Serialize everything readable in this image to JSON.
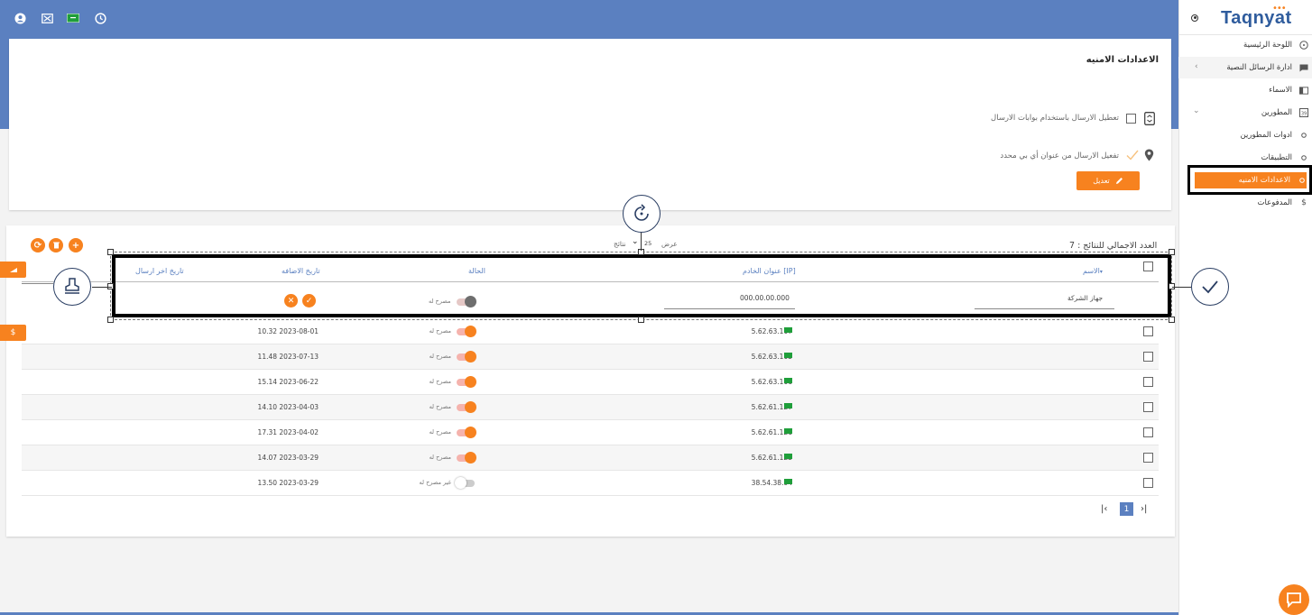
{
  "brand": {
    "name": "Taqnyat",
    "accent": "#f7821f",
    "primary": "#5b80c0"
  },
  "topbar": {
    "icons": [
      "user-icon",
      "expand-icon",
      "flag-icon",
      "clock-icon"
    ]
  },
  "sidebar": {
    "items": [
      {
        "label": "اللوحة الرئيسية",
        "icon": "dashboard-icon"
      },
      {
        "label": "ادارة الرسائل النصية",
        "icon": "message-icon"
      },
      {
        "label": "الاسماء",
        "icon": "names-icon"
      },
      {
        "label": "المطورين",
        "icon": "developers-icon"
      },
      {
        "label": "ادوات المطورين",
        "icon": "circle-icon"
      },
      {
        "label": "التطبيقات",
        "icon": "circle-icon"
      },
      {
        "label": "الاعدادات الامنيه",
        "icon": "circle-icon",
        "active": true
      },
      {
        "label": "المدفوعات",
        "icon": "dollar-icon"
      }
    ]
  },
  "settings": {
    "title": "الاعدادات الامنيه",
    "option1": "تعطيل الارسال باستخدام بوابات الارسال",
    "option2": "تفعيل الارسال من عنوان أي بي محدد",
    "edit_label": "تعديل"
  },
  "table": {
    "total_label": "العدد الاجمالي للنتائج : 7",
    "show_label": "عرض",
    "page_size": "25",
    "results_label": "نتائج",
    "headers": {
      "name": "الاسم",
      "ip": "عنوان الخادم [IP]",
      "status": "الحالة",
      "added": "تاريخ الاضافه",
      "last_sent": "تاريخ اخر ارسال"
    },
    "new_row": {
      "name": "جهاز الشركة",
      "ip": "000.00.00.000",
      "status": "مصرح له"
    },
    "rows": [
      {
        "ip": "5.62.63.107",
        "status": "مصرح له",
        "enabled": true,
        "added": "10.32 2023-08-01"
      },
      {
        "ip": "5.62.63.105",
        "status": "مصرح له",
        "enabled": true,
        "added": "11.48 2023-07-13"
      },
      {
        "ip": "5.62.63.106",
        "status": "مصرح له",
        "enabled": true,
        "added": "15.14 2023-06-22"
      },
      {
        "ip": "5.62.61.127",
        "status": "مصرح له",
        "enabled": true,
        "added": "14.10 2023-04-03"
      },
      {
        "ip": "5.62.61.126",
        "status": "مصرح له",
        "enabled": true,
        "added": "17.31 2023-04-02"
      },
      {
        "ip": "5.62.61.125",
        "status": "مصرح له",
        "enabled": true,
        "added": "14.07 2023-03-29"
      },
      {
        "ip": "38.54.38.94",
        "status": "غير مصرح له",
        "enabled": false,
        "added": "13.50 2023-03-29"
      }
    ],
    "pager": {
      "current": "1"
    }
  }
}
